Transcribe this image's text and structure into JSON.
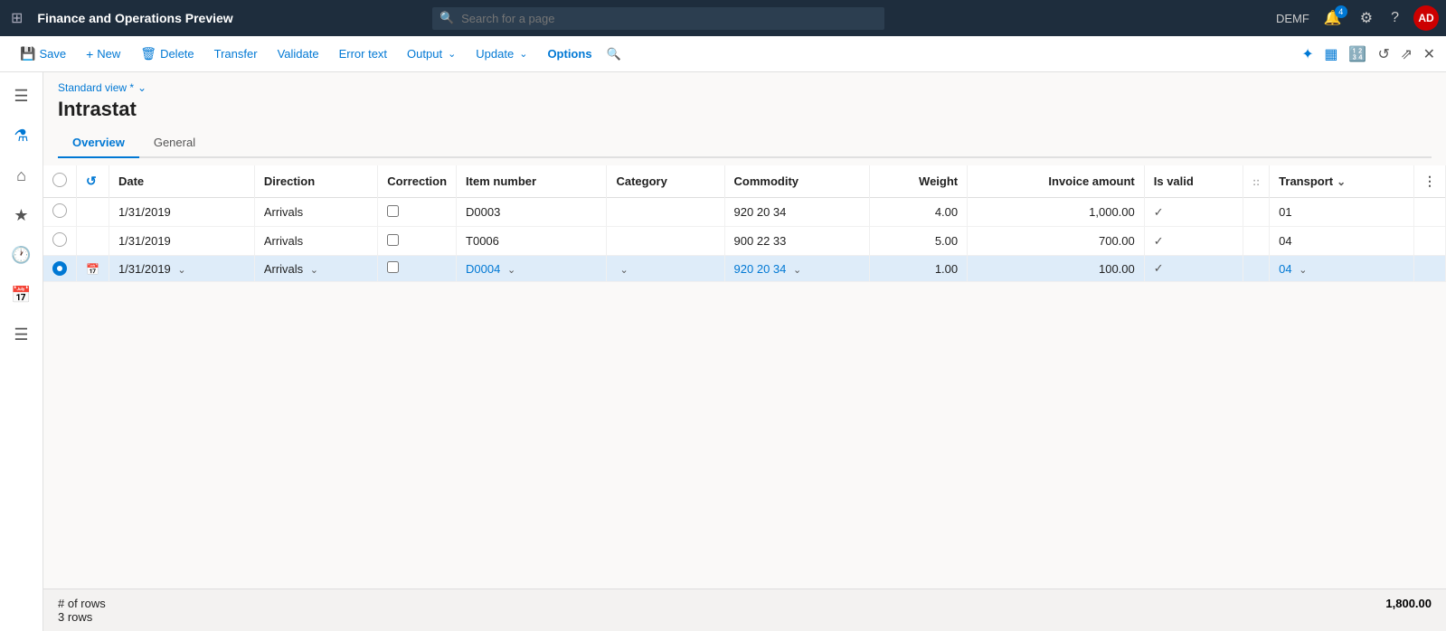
{
  "app": {
    "title": "Finance and Operations Preview",
    "env": "DEMF"
  },
  "search": {
    "placeholder": "Search for a page"
  },
  "toolbar": {
    "save": "Save",
    "new": "New",
    "delete": "Delete",
    "transfer": "Transfer",
    "validate": "Validate",
    "error_text": "Error text",
    "output": "Output",
    "update": "Update",
    "options": "Options"
  },
  "sidebar": {
    "icons": [
      "☰",
      "⌂",
      "★",
      "🕐",
      "📅",
      "☰"
    ]
  },
  "page": {
    "view_label": "Standard view *",
    "title": "Intrastat"
  },
  "tabs": [
    {
      "label": "Overview",
      "active": true
    },
    {
      "label": "General",
      "active": false
    }
  ],
  "table": {
    "columns": [
      {
        "key": "selector",
        "label": ""
      },
      {
        "key": "refresh",
        "label": ""
      },
      {
        "key": "date",
        "label": "Date"
      },
      {
        "key": "direction",
        "label": "Direction"
      },
      {
        "key": "correction",
        "label": "Correction"
      },
      {
        "key": "item_number",
        "label": "Item number"
      },
      {
        "key": "category",
        "label": "Category"
      },
      {
        "key": "commodity",
        "label": "Commodity"
      },
      {
        "key": "weight",
        "label": "Weight",
        "align": "right"
      },
      {
        "key": "invoice_amount",
        "label": "Invoice amount",
        "align": "right"
      },
      {
        "key": "is_valid",
        "label": "Is valid"
      },
      {
        "key": "transport_drag",
        "label": ""
      },
      {
        "key": "transport",
        "label": "Transport"
      },
      {
        "key": "transport_more",
        "label": ""
      }
    ],
    "rows": [
      {
        "selected": false,
        "date": "1/31/2019",
        "direction": "Arrivals",
        "correction": false,
        "item_number": "D0003",
        "item_number_link": false,
        "category": "",
        "commodity": "920 20 34",
        "weight": "4.00",
        "invoice_amount": "1,000.00",
        "is_valid": true,
        "transport": "01"
      },
      {
        "selected": false,
        "date": "1/31/2019",
        "direction": "Arrivals",
        "correction": false,
        "item_number": "T0006",
        "item_number_link": false,
        "category": "",
        "commodity": "900 22 33",
        "weight": "5.00",
        "invoice_amount": "700.00",
        "is_valid": true,
        "transport": "04"
      },
      {
        "selected": true,
        "date": "1/31/2019",
        "direction": "Arrivals",
        "correction": false,
        "item_number": "D0004",
        "item_number_link": true,
        "category": "",
        "commodity": "920 20 34",
        "weight": "1.00",
        "invoice_amount": "100.00",
        "is_valid": true,
        "transport": "04"
      }
    ]
  },
  "footer": {
    "rows_label": "# of rows",
    "rows_count": "3 rows",
    "total": "1,800.00"
  },
  "top_right": {
    "notification_count": "4",
    "avatar_initials": "AD"
  }
}
